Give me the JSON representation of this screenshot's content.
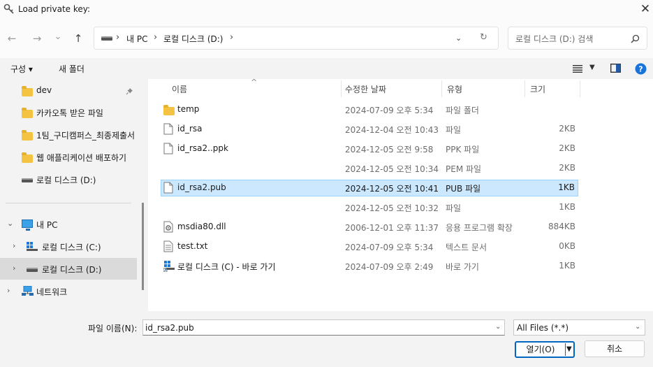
{
  "window": {
    "title": "Load private key:",
    "close_glyph": "✕"
  },
  "nav": {
    "back": "←",
    "forward": "→",
    "recent": "⌄",
    "up": "↑",
    "address_segments": [
      "내 PC",
      "로컬 디스크 (D:)"
    ],
    "refresh": "↻",
    "search_placeholder": "로컬 디스크 (D:) 검색"
  },
  "commandbar": {
    "organize": "구성 ▾",
    "new_folder": "새 폴더"
  },
  "sidebar": {
    "items": [
      {
        "label": "dev",
        "icon": "folder-icon",
        "pinned": true
      },
      {
        "label": "카카오톡 받은 파일",
        "icon": "folder-icon"
      },
      {
        "label": "1팀_구디캠퍼스_최종제출서",
        "icon": "folder-icon"
      },
      {
        "label": "웹 애플리케이션 배포하기",
        "icon": "folder-icon"
      },
      {
        "label": "로컬 디스크 (D:)",
        "icon": "drive-icon"
      },
      {
        "label": "내 PC",
        "icon": "pc-icon",
        "expanded": true
      },
      {
        "label": "로컬 디스크 (C:)",
        "icon": "windows-drive-icon"
      },
      {
        "label": "로컬 디스크 (D:)",
        "icon": "drive-icon",
        "selected": true
      },
      {
        "label": "네트워크",
        "icon": "network-icon"
      }
    ]
  },
  "columns": {
    "name": "이름",
    "date": "수정한 날짜",
    "type": "유형",
    "size": "크기"
  },
  "files": [
    {
      "name": "temp",
      "date": "2024-07-09 오후 5:34",
      "type": "파일 폴더",
      "size": "",
      "icon": "folder-icon"
    },
    {
      "name": "id_rsa",
      "date": "2024-12-04 오전 10:43",
      "type": "파일",
      "size": "2KB",
      "icon": "file-icon"
    },
    {
      "name": "id_rsa2..ppk",
      "date": "2024-12-05 오전 9:58",
      "type": "PPK 파일",
      "size": "2KB",
      "icon": "file-icon"
    },
    {
      "name": "",
      "date": "2024-12-05 오전 10:34",
      "type": "PEM 파일",
      "size": "2KB",
      "icon": ""
    },
    {
      "name": "id_rsa2.pub",
      "date": "2024-12-05 오전 10:41",
      "type": "PUB 파일",
      "size": "1KB",
      "icon": "file-icon",
      "selected": true
    },
    {
      "name": "",
      "date": "2024-12-05 오전 10:32",
      "type": "파일",
      "size": "1KB",
      "icon": ""
    },
    {
      "name": "msdia80.dll",
      "date": "2006-12-01 오후 11:37",
      "type": "응용 프로그램 확장",
      "size": "884KB",
      "icon": "dll-icon"
    },
    {
      "name": "test.txt",
      "date": "2024-07-09 오후 5:34",
      "type": "텍스트 문서",
      "size": "0KB",
      "icon": "text-file-icon"
    },
    {
      "name": "로컬 디스크 (C) - 바로 가기",
      "date": "2024-07-09 오후 2:49",
      "type": "바로 가기",
      "size": "1KB",
      "icon": "shortcut-icon"
    }
  ],
  "footer": {
    "filename_label": "파일 이름(N):",
    "filename_value": "id_rsa2.pub",
    "filetype_value": "All Files (*.*)",
    "open_label": "열기(O)",
    "cancel_label": "취소"
  },
  "colors": {
    "accent": "#0067c0",
    "selection": "#cce8ff",
    "folder": "#f5c342"
  }
}
